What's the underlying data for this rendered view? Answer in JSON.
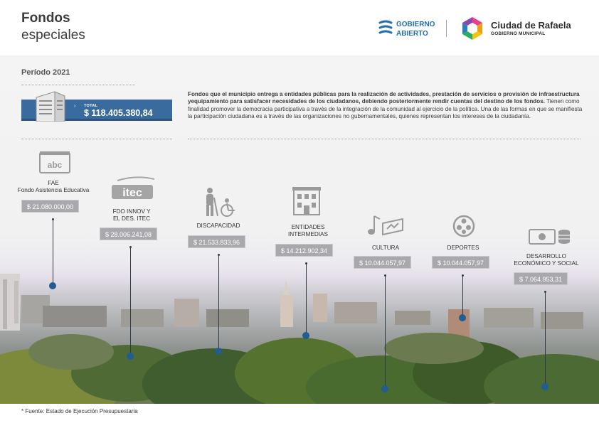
{
  "header": {
    "title_line1": "Fondos",
    "title_line2": "especiales",
    "gobierno_abierto_line1": "GOBIERNO",
    "gobierno_abierto_line2": "ABIERTO",
    "city_name": "Ciudad de Rafaela",
    "city_subtitle": "GOBIERNO MUNICIPAL"
  },
  "period": "Período 2021",
  "total": {
    "label": "TOTAL",
    "value": "$ 118.405.380,84"
  },
  "description": {
    "bold": "Fondos que el municipio entrega a entidades públicas para la realización de actividades, prestación de servicios o provisión de infraestructura yequipamiento para satisfacer necesidades de los ciudadanos, debiendo posteriormente rendir cuentas del destino de los fondos.",
    "regular": " Tienen como finalidad promover la democracia participativa a través de la integración de la comunidad al ejercicio de la política. Una de las formas en que se manifiesta la participación ciudadana es a través de las organizaciones no gubernamentales, quienes representan los intereses de la ciudadanía."
  },
  "funds": [
    {
      "label_line1": "FAE",
      "label_line2": "Fondo Asistencia Educativa",
      "amount": "$ 21.080.000,00",
      "icon": "abc-book-icon",
      "icon_text": "abc"
    },
    {
      "label_line1": "FDO INNOV Y",
      "label_line2": "EL DES. ITEC",
      "amount": "$ 28.006.241,08",
      "icon": "itec-logo-icon",
      "icon_text": "itec"
    },
    {
      "label_line1": "DISCAPACIDAD",
      "label_line2": "",
      "amount": "$ 21.533.833,96",
      "icon": "disability-icon"
    },
    {
      "label_line1": "ENTIDADES",
      "label_line2": "INTERMEDIAS",
      "amount": "$ 14.212.902,34",
      "icon": "building-icon"
    },
    {
      "label_line1": "CULTURA",
      "label_line2": "",
      "amount": "$ 10.044.057,97",
      "icon": "music-ticket-icon"
    },
    {
      "label_line1": "DEPORTES",
      "label_line2": "",
      "amount": "$ 10.044.057,97",
      "icon": "film-reel-icon"
    },
    {
      "label_line1": "DESARROLLO",
      "label_line2": "ECONÓMICO Y SOCIAL",
      "amount": "$ 7.064.953,31",
      "icon": "money-coins-icon"
    }
  ],
  "footnote": "* Fuente: Estado de Ejecución Presupuestaria",
  "colors": {
    "accent_blue": "#3a6b9f",
    "dot_blue": "#1f5d93",
    "amount_gray": "#a9a9ad",
    "brand_blue": "#1f6fb3"
  }
}
